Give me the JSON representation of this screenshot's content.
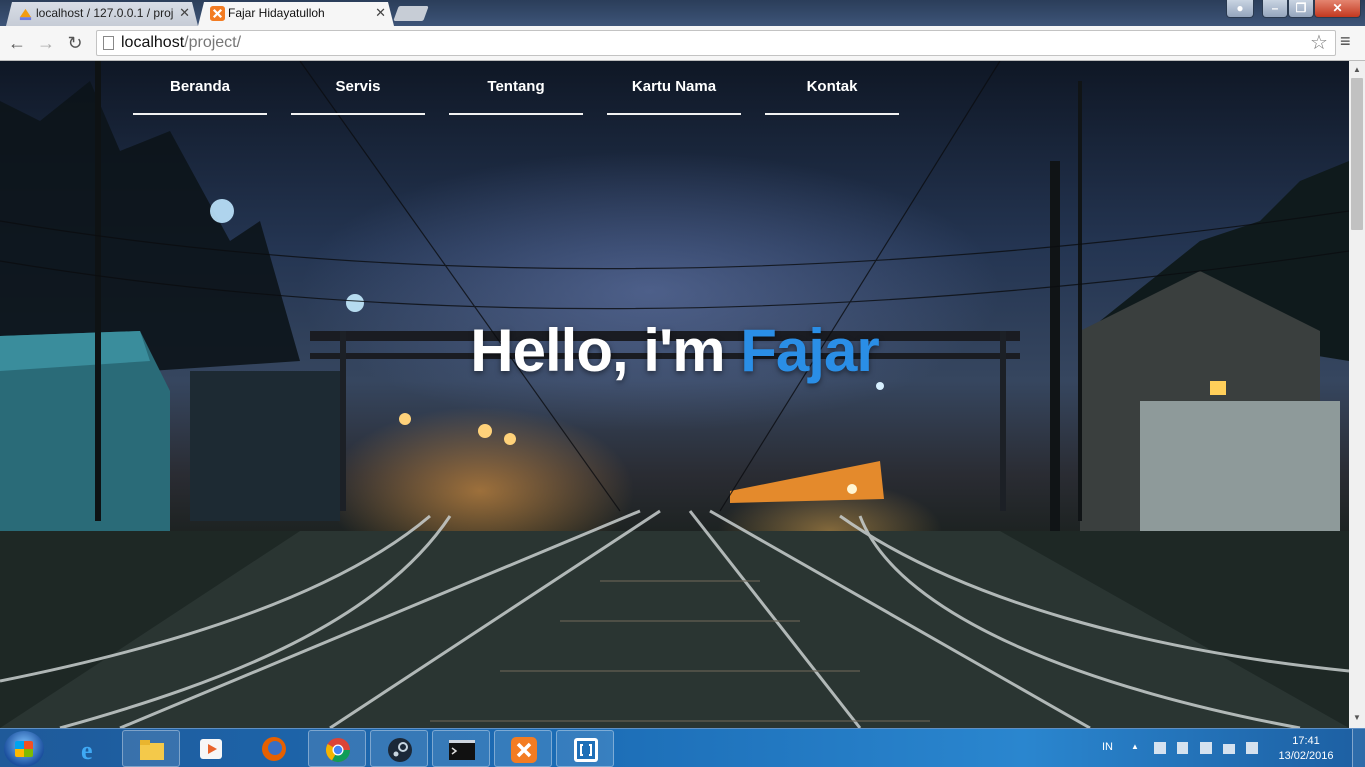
{
  "browser": {
    "tabs": [
      {
        "title": "localhost / 127.0.0.1 / proj",
        "active": false
      },
      {
        "title": "Fajar Hidayatulloh",
        "active": true
      }
    ],
    "url_host": "localhost",
    "url_path": "/project/"
  },
  "page": {
    "nav": [
      "Beranda",
      "Servis",
      "Tentang",
      "Kartu Nama",
      "Kontak"
    ],
    "hero_prefix": "Hello, i'm ",
    "hero_name": "Fajar",
    "accent_color": "#2a8ee6"
  },
  "taskbar": {
    "apps": [
      "ie-icon",
      "file-explorer-icon",
      "media-player-icon",
      "firefox-icon",
      "chrome-icon",
      "steam-icon",
      "cmd-icon",
      "xampp-icon",
      "brackets-icon"
    ],
    "language": "IN",
    "time": "17:41",
    "date": "13/02/2016"
  }
}
